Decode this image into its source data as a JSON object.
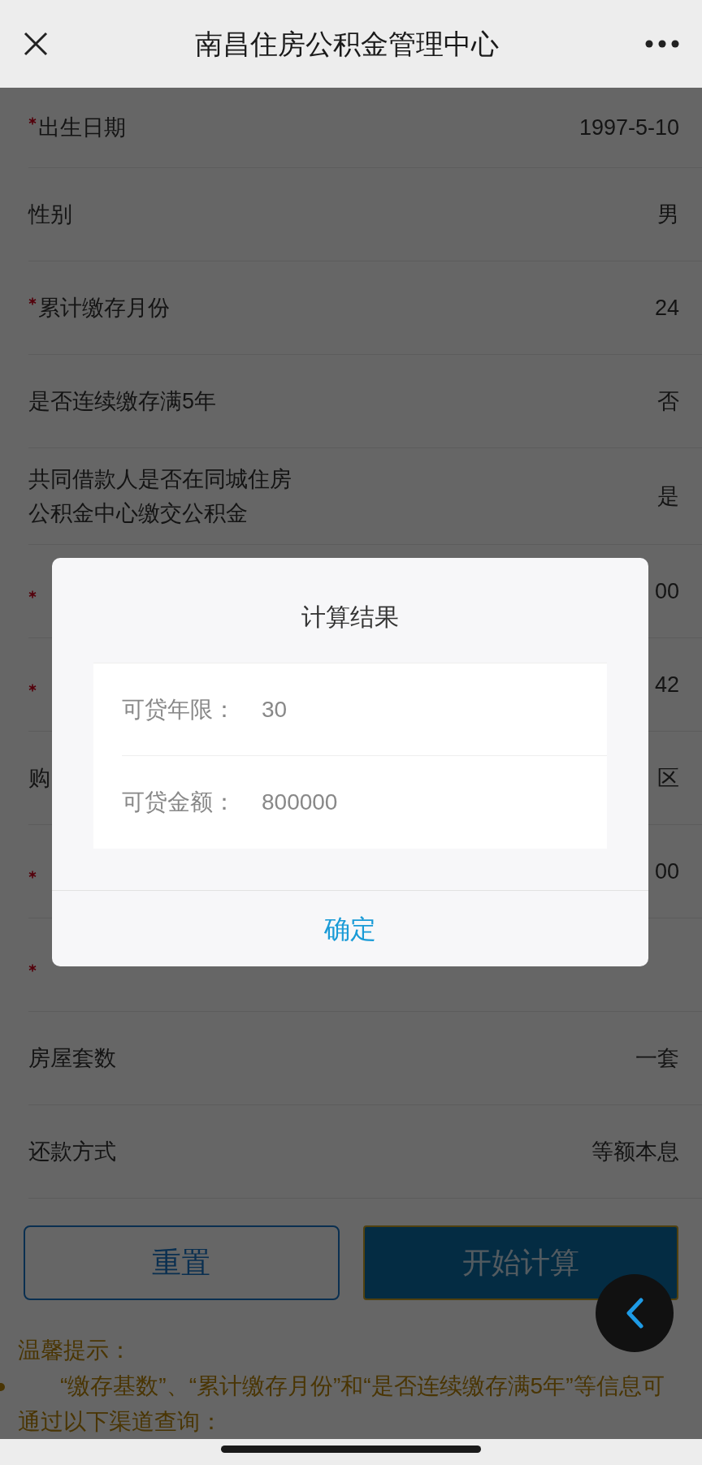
{
  "top_bar": {
    "title": "南昌住房公积金管理中心"
  },
  "form_rows": [
    {
      "label": "出生日期",
      "required": true,
      "value": "1997-5-10"
    },
    {
      "label": "性别",
      "required": false,
      "value": "男"
    },
    {
      "label": "累计缴存月份",
      "required": true,
      "value": "24"
    },
    {
      "label": "是否连续缴存满5年",
      "required": false,
      "value": "否"
    },
    {
      "label": "共同借款人是否在同城住房公积金中心缴交公积金",
      "required": false,
      "value": "是"
    },
    {
      "required": true,
      "value": "00"
    },
    {
      "required": true,
      "value": "42"
    },
    {
      "label": "购",
      "required": false,
      "value": "区"
    },
    {
      "required": true,
      "value": "00"
    },
    {
      "required": true
    },
    {
      "label": "房屋套数",
      "required": false,
      "value": "一套"
    },
    {
      "label": "还款方式",
      "required": false,
      "value": "等额本息"
    }
  ],
  "buttons": [
    {
      "label": "重置",
      "kind": "outline"
    },
    {
      "label": "开始计算",
      "kind": "primary"
    }
  ],
  "tip": {
    "title": "温馨提示：",
    "items": [
      "“缴存基数”、“累计缴存月份”和“是否连续缴存满5年”等信息可通过以下渠道查询："
    ]
  },
  "dialog": {
    "title": "计算结果",
    "rows": [
      {
        "label": "可贷年限：",
        "value": "30"
      },
      {
        "label": "可贷金额：",
        "value": "800000"
      }
    ],
    "confirm": "确定"
  }
}
